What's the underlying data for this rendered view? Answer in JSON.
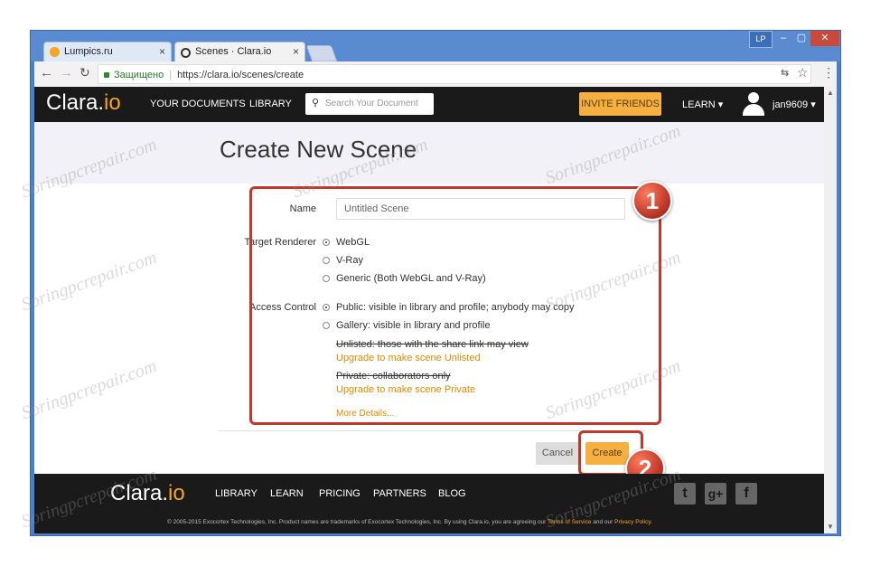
{
  "browser": {
    "tabs": [
      {
        "label": "Lumpics.ru",
        "favicon_color": "#f5a623"
      },
      {
        "label": "Scenes · Clara.io",
        "favicon_color": "#333333"
      }
    ],
    "window_badge": "LP",
    "url_secure_label": "Защищено",
    "url": "https://clara.io/scenes/create"
  },
  "header": {
    "logo_main": "Clara.",
    "logo_suffix": "io",
    "nav": [
      "YOUR DOCUMENTS",
      "LIBRARY"
    ],
    "search_placeholder": "Search Your Document",
    "invite": "INVITE FRIENDS",
    "learn": "LEARN",
    "user": "jan9609"
  },
  "page": {
    "title": "Create New Scene",
    "name_label": "Name",
    "name_value": "Untitled Scene",
    "renderer_label": "Target Renderer",
    "renderers": [
      {
        "label": "WebGL",
        "selected": true
      },
      {
        "label": "V-Ray",
        "selected": false
      },
      {
        "label": "Generic (Both WebGL and V-Ray)",
        "selected": false
      }
    ],
    "access_label": "Access Control",
    "access": [
      {
        "label": "Public: visible in library and profile; anybody may copy",
        "selected": true
      },
      {
        "label": "Gallery: visible in library and profile",
        "selected": false
      }
    ],
    "unlisted_label": "Unlisted: those with the share link may view",
    "unlisted_upgrade": "Upgrade to make scene Unlisted",
    "private_label": "Private: collaborators only",
    "private_upgrade": "Upgrade to make scene Private",
    "more_details": "More Details...",
    "cancel": "Cancel",
    "create": "Create"
  },
  "annotations": {
    "one": "1",
    "two": "2"
  },
  "footer": {
    "logo_main": "Clara.",
    "logo_suffix": "io",
    "links": [
      "LIBRARY",
      "LEARN",
      "PRICING",
      "PARTNERS",
      "BLOG"
    ],
    "copyright_a": "© 2005-2015 Exocortex Technologies, Inc. Product names are trademarks of Exocortex Technologies, Inc. By using Clara.io, you are agreeing our ",
    "terms": "Terms of Service",
    "and": " and our ",
    "privacy": "Privacy Policy",
    "period": "."
  },
  "watermark": "Soringpcrepair.com",
  "colors": {
    "accent": "#f5a623",
    "highlight": "#c0392b",
    "header_bg": "#1a1a1a"
  }
}
